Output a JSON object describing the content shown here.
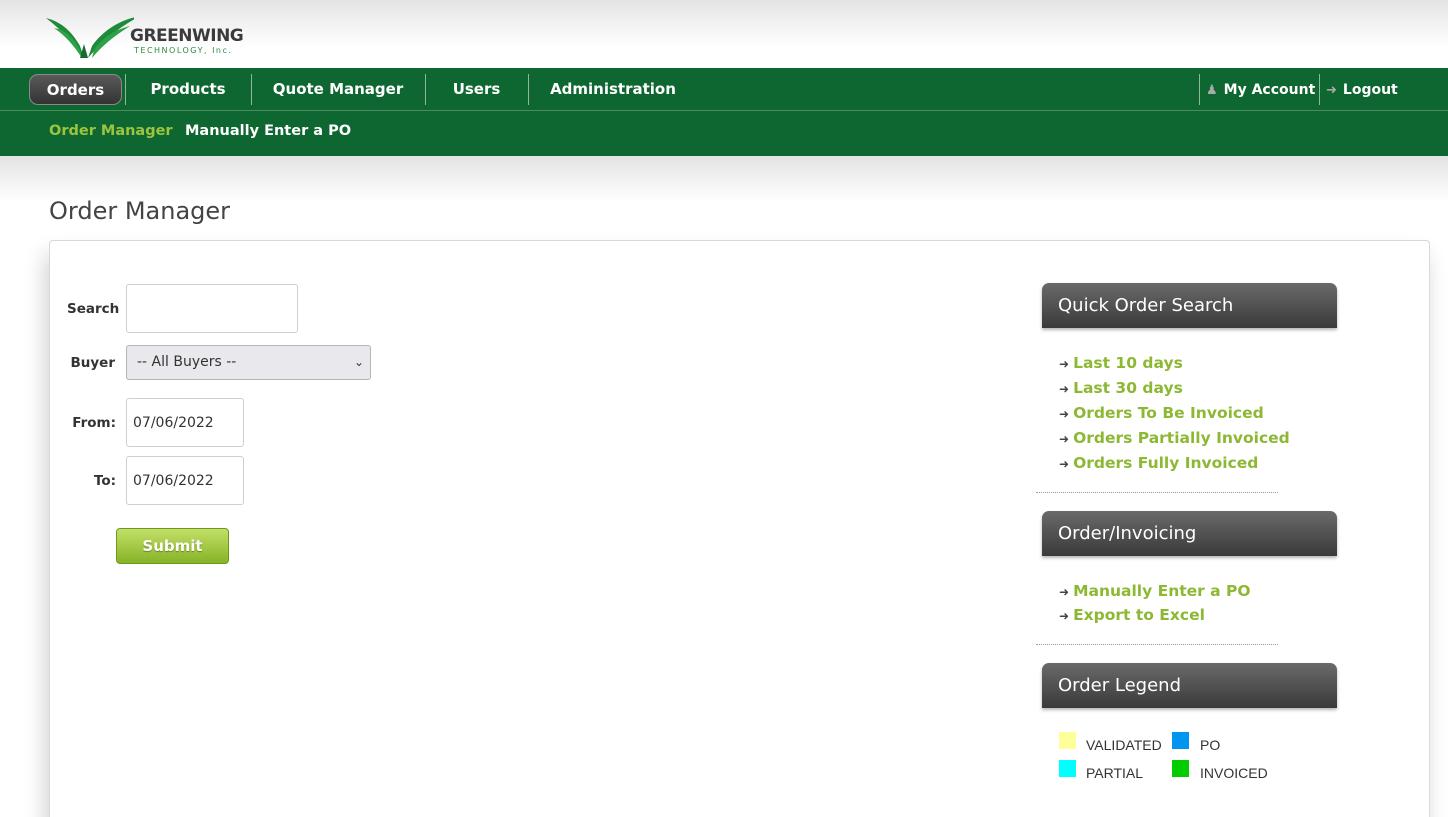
{
  "logo": {
    "name": "GREENWING",
    "sub": "TECHNOLOGY, Inc."
  },
  "nav": {
    "items": [
      {
        "label": "Orders"
      },
      {
        "label": "Products"
      },
      {
        "label": "Quote Manager"
      },
      {
        "label": "Users"
      },
      {
        "label": "Administration"
      }
    ],
    "account_label": "My Account",
    "logout_label": "Logout"
  },
  "subnav": {
    "items": [
      {
        "label": "Order Manager"
      },
      {
        "label": "Manually Enter a PO"
      }
    ]
  },
  "page_title": "Order Manager",
  "form": {
    "search_label": "Search",
    "search_value": "",
    "buyer_label": "Buyer",
    "buyer_selected": "-- All Buyers --",
    "from_label": "From:",
    "from_value": "07/06/2022",
    "to_label": "To:",
    "to_value": "07/06/2022",
    "submit_label": "Submit"
  },
  "sidebar": {
    "quick_search": {
      "title": "Quick Order Search",
      "links": [
        "Last 10 days",
        "Last 30 days",
        "Orders To Be Invoiced",
        "Orders Partially Invoiced",
        "Orders Fully Invoiced"
      ]
    },
    "invoicing": {
      "title": "Order/Invoicing",
      "links": [
        "Manually Enter a PO",
        "Export to Excel"
      ]
    },
    "legend": {
      "title": "Order Legend",
      "items": [
        {
          "label": "VALIDATED",
          "color": "#ffff99"
        },
        {
          "label": "PO",
          "color": "#0096f0"
        },
        {
          "label": "PARTIAL",
          "color": "#00ffff"
        },
        {
          "label": "INVOICED",
          "color": "#00cc00"
        }
      ]
    }
  },
  "colors": {
    "nav_green": "#0e6731",
    "link_green": "#8db834"
  }
}
